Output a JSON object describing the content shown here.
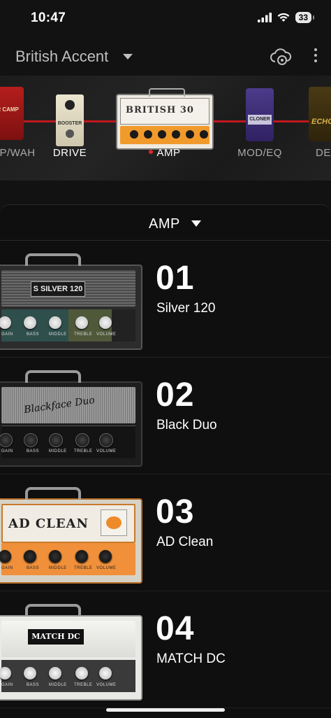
{
  "status": {
    "time": "10:47",
    "battery": "33"
  },
  "header": {
    "preset": "British Accent"
  },
  "chain": {
    "items": [
      {
        "id": "wah",
        "label": "P/WAH",
        "pedal_text": "ER CAMP"
      },
      {
        "id": "drive",
        "label": "DRIVE",
        "pedal_text": "BOOSTER"
      },
      {
        "id": "amp",
        "label": "AMP",
        "pedal_text": "BRITISH 30",
        "active": true
      },
      {
        "id": "modeq",
        "label": "MOD/EQ",
        "pedal_text": "CLONER"
      },
      {
        "id": "delay",
        "label": "DE",
        "pedal_text": "ECHO"
      }
    ]
  },
  "sheet": {
    "title": "AMP"
  },
  "amps": [
    {
      "number": "01",
      "name": "Silver 120",
      "badge": "S  SILVER 120"
    },
    {
      "number": "02",
      "name": "Black Duo",
      "badge": "Blackface Duo"
    },
    {
      "number": "03",
      "name": "AD Clean",
      "badge": "AD CLEAN"
    },
    {
      "number": "04",
      "name": "MATCH DC",
      "badge": "MATCH DC"
    }
  ],
  "knob_labels": [
    "GAIN",
    "BASS",
    "MIDDLE",
    "TREBLE",
    "VOLUME"
  ],
  "colors": {
    "cable": "#c0181e",
    "active_dot": "#e0262c",
    "amp_panel_orange": "#f19a2c"
  }
}
